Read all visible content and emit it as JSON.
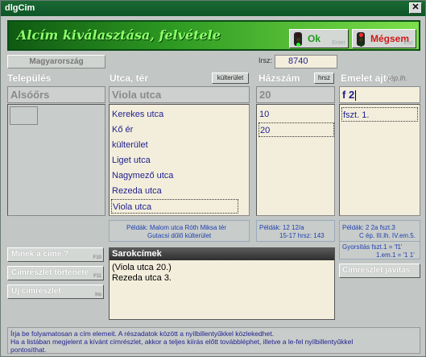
{
  "window": {
    "title": "dlgCim",
    "close_label": "✕"
  },
  "header": {
    "title": "Alcím kiválasztása, felvétele",
    "ok": {
      "label": "Ok",
      "key": "Enter"
    },
    "cancel": {
      "label": "Mégsem",
      "key": "Esc"
    }
  },
  "country_button": "Magyarország",
  "hrsz": {
    "label": "Irsz:",
    "value": "8740"
  },
  "columns": {
    "telepules": "Település",
    "utca": "Utca, tér",
    "kulterulet_btn": "külterület",
    "hazszam": "Házszám",
    "hrsz_btn": "hrsz",
    "emelet": "Emelet ajtó",
    "emelet_hint": "(ép.lh."
  },
  "inputs": {
    "telepules_value": "Alsóőrs",
    "utca_value": "Viola utca",
    "hazszam_value": "20",
    "emelet_value": "f 2"
  },
  "street_list": [
    "Kerekes utca",
    "Kő ér",
    "külterület",
    "Liget utca",
    "Nagymező utca",
    "Rezeda utca",
    "Viola utca"
  ],
  "street_selected_index": 6,
  "house_list": [
    "10",
    "20"
  ],
  "house_selected_index": 1,
  "floor_list": [
    "fszt.  1."
  ],
  "hints": {
    "street_1": "Példák:  Malom utca     Róth Miksa tér",
    "street_2": "Gutacsi dűlő    külterület",
    "house_1": "Példák:     12         12/a",
    "house_2": "15-17       hrsz: 143",
    "floor_1": "Példák:   2     2a     fszt.3",
    "floor_2": "C ép. III.lh. IV.em.5.",
    "gyors_1": "Gyorsítás   fszt.1 = 'f1'",
    "gyors_2": "1.em.1 = '1 1'"
  },
  "side_buttons": [
    {
      "label": "Minek a címe ?",
      "key": "F10"
    },
    {
      "label": "Címrészlet története",
      "key": "F11"
    },
    {
      "label": "Új címrészlet",
      "key": "Ins"
    }
  ],
  "corner": {
    "title": "Sarokcímek",
    "items": [
      "(Viola utca  20.)",
      "Rezeda utca   3."
    ]
  },
  "fix_button": "Címrészlet javítás",
  "info": {
    "line1": "Írja be folyamatosan a cím elemeit. A részadatok között a nyílbillentyűkkel közlekedhet.",
    "line2": "Ha a listában megjelent a kívánt címrészlet, akkor a teljes kiírás előtt továbbléphet, illetve a le-fel nyílbillentyűkkel",
    "line3": "pontosíthat."
  }
}
